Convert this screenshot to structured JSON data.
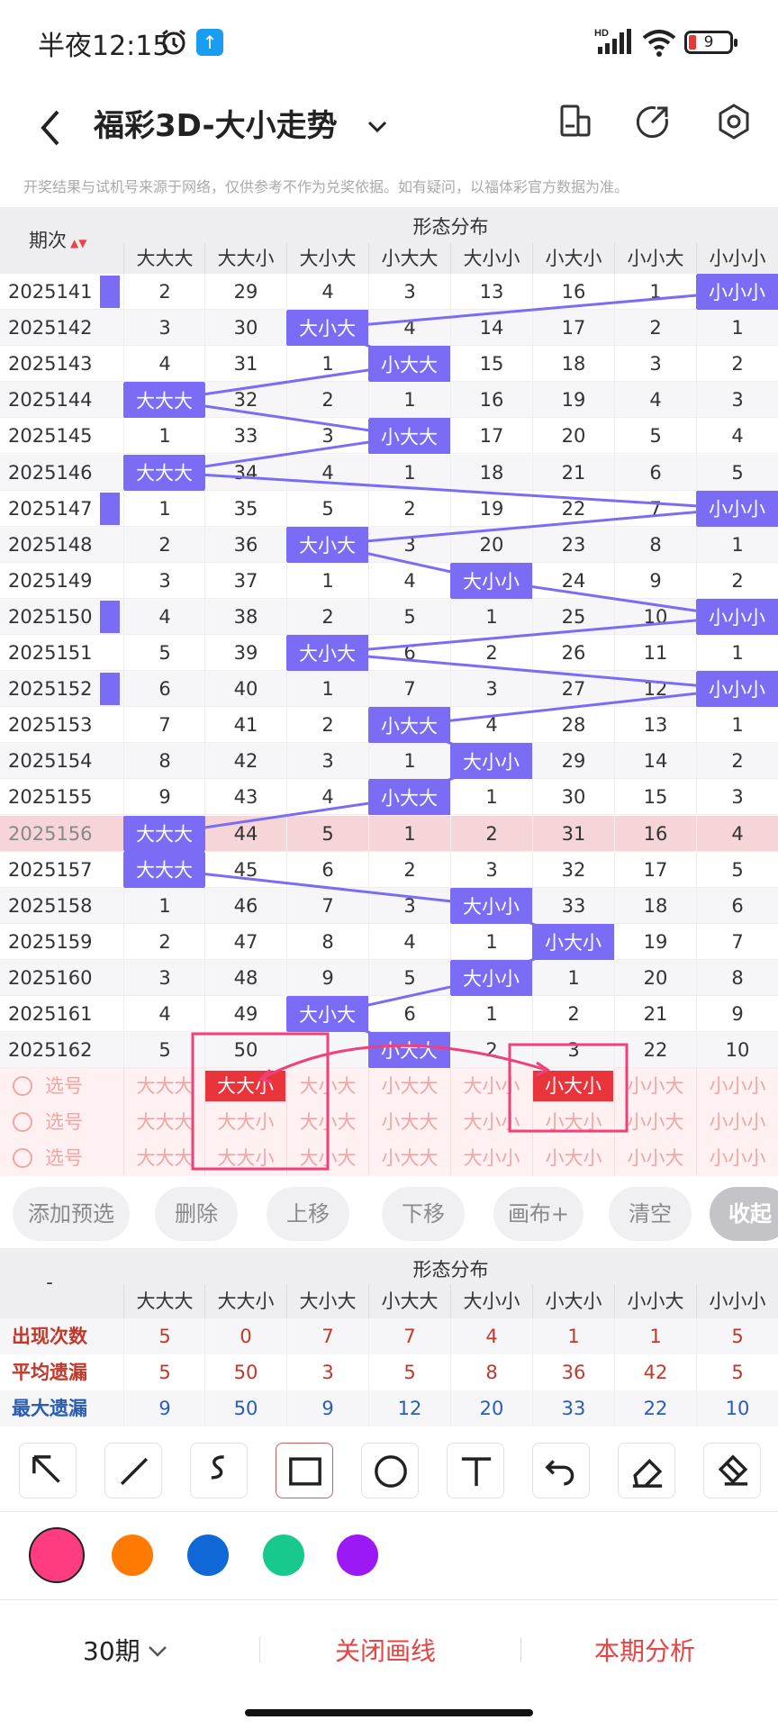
{
  "status": {
    "time": "半夜12:15",
    "battery": "9",
    "network": "HD"
  },
  "header": {
    "title": "福彩3D-大小走势",
    "disclaimer": "开奖结果与试机号来源于网络，仅供参考不作为兑奖依据。如有疑问，以福体彩官方数据为准。"
  },
  "table": {
    "period_label": "期次",
    "group_label": "形态分布",
    "columns": [
      "大大大",
      "大大小",
      "大小大",
      "小大大",
      "大小小",
      "小大小",
      "小小大",
      "小小小"
    ],
    "rows": [
      {
        "period": "2025141",
        "values": [
          "2",
          "29",
          "4",
          "3",
          "13",
          "16",
          "1",
          "小小小"
        ]
      },
      {
        "period": "2025142",
        "values": [
          "3",
          "30",
          "大小大",
          "4",
          "14",
          "17",
          "2",
          "1"
        ]
      },
      {
        "period": "2025143",
        "values": [
          "4",
          "31",
          "1",
          "小大大",
          "15",
          "18",
          "3",
          "2"
        ]
      },
      {
        "period": "2025144",
        "values": [
          "大大大",
          "32",
          "2",
          "1",
          "16",
          "19",
          "4",
          "3"
        ]
      },
      {
        "period": "2025145",
        "values": [
          "1",
          "33",
          "3",
          "小大大",
          "17",
          "20",
          "5",
          "4"
        ]
      },
      {
        "period": "2025146",
        "values": [
          "大大大",
          "34",
          "4",
          "1",
          "18",
          "21",
          "6",
          "5"
        ]
      },
      {
        "period": "2025147",
        "values": [
          "1",
          "35",
          "5",
          "2",
          "19",
          "22",
          "7",
          "小小小"
        ]
      },
      {
        "period": "2025148",
        "values": [
          "2",
          "36",
          "大小大",
          "3",
          "20",
          "23",
          "8",
          "1"
        ]
      },
      {
        "period": "2025149",
        "values": [
          "3",
          "37",
          "1",
          "4",
          "大小小",
          "24",
          "9",
          "2"
        ]
      },
      {
        "period": "2025150",
        "values": [
          "4",
          "38",
          "2",
          "5",
          "1",
          "25",
          "10",
          "小小小"
        ]
      },
      {
        "period": "2025151",
        "values": [
          "5",
          "39",
          "大小大",
          "6",
          "2",
          "26",
          "11",
          "1"
        ]
      },
      {
        "period": "2025152",
        "values": [
          "6",
          "40",
          "1",
          "7",
          "3",
          "27",
          "12",
          "小小小"
        ]
      },
      {
        "period": "2025153",
        "values": [
          "7",
          "41",
          "2",
          "小大大",
          "4",
          "28",
          "13",
          "1"
        ]
      },
      {
        "period": "2025154",
        "values": [
          "8",
          "42",
          "3",
          "1",
          "大小小",
          "29",
          "14",
          "2"
        ]
      },
      {
        "period": "2025155",
        "values": [
          "9",
          "43",
          "4",
          "小大大",
          "1",
          "30",
          "15",
          "3"
        ]
      },
      {
        "period": "2025156",
        "values": [
          "大大大",
          "44",
          "5",
          "1",
          "2",
          "31",
          "16",
          "4"
        ]
      },
      {
        "period": "2025157",
        "values": [
          "大大大",
          "45",
          "6",
          "2",
          "3",
          "32",
          "17",
          "5"
        ]
      },
      {
        "period": "2025158",
        "values": [
          "1",
          "46",
          "7",
          "3",
          "大小小",
          "33",
          "18",
          "6"
        ]
      },
      {
        "period": "2025159",
        "values": [
          "2",
          "47",
          "8",
          "4",
          "1",
          "小大小",
          "19",
          "7"
        ]
      },
      {
        "period": "2025160",
        "values": [
          "3",
          "48",
          "9",
          "5",
          "大小小",
          "1",
          "20",
          "8"
        ]
      },
      {
        "period": "2025161",
        "values": [
          "4",
          "49",
          "大小大",
          "6",
          "1",
          "2",
          "21",
          "9"
        ]
      },
      {
        "period": "2025162",
        "values": [
          "5",
          "50",
          "",
          "小大大",
          "2",
          "3",
          "22",
          "10"
        ]
      }
    ],
    "hit_col_index": [
      7,
      2,
      3,
      0,
      3,
      0,
      7,
      2,
      4,
      7,
      2,
      7,
      3,
      4,
      3,
      0,
      0,
      4,
      5,
      4,
      2,
      3
    ],
    "select_label": "选号",
    "select_rows": 3,
    "selected": {
      "row": 0,
      "col": 1,
      "label": "大大小"
    },
    "selected2": {
      "row": 0,
      "col": 5,
      "label": "小大小"
    }
  },
  "actions": [
    "添加预选",
    "删除",
    "上移",
    "下移",
    "画布+",
    "清空",
    "收起"
  ],
  "stats": {
    "corner": "-",
    "group_label": "形态分布",
    "rows": [
      {
        "label": "出现次数",
        "values": [
          "5",
          "0",
          "7",
          "7",
          "4",
          "1",
          "1",
          "5"
        ]
      },
      {
        "label": "平均遗漏",
        "values": [
          "5",
          "50",
          "3",
          "5",
          "8",
          "36",
          "42",
          "5"
        ]
      },
      {
        "label": "最大遗漏",
        "values": [
          "9",
          "50",
          "9",
          "12",
          "20",
          "33",
          "22",
          "10"
        ]
      }
    ]
  },
  "tools": [
    "pointer-icon",
    "line-icon",
    "curve-icon",
    "rectangle-icon",
    "circle-icon",
    "text-icon",
    "undo-icon",
    "eraser-icon",
    "clear-icon"
  ],
  "colors": [
    "#ff3c7f",
    "#ff7a00",
    "#0f68d6",
    "#17c98c",
    "#9b19f5"
  ],
  "bottom": {
    "period_select": "30期",
    "close_lines": "关闭画线",
    "analysis": "本期分析"
  },
  "accent": "#7b6cf5",
  "highlight_row": "2025156"
}
